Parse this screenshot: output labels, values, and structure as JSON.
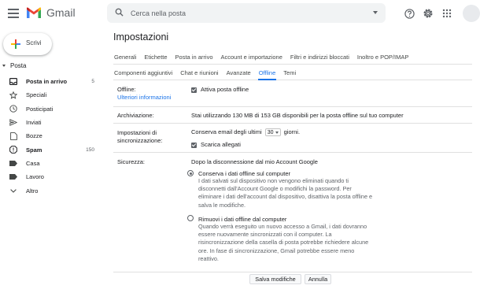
{
  "app": {
    "name": "Gmail"
  },
  "search": {
    "placeholder": "Cerca nella posta"
  },
  "compose": {
    "label": "Scrivi"
  },
  "sidebar": {
    "section": "Posta",
    "items": [
      {
        "label": "Posta in arrivo",
        "count": "5",
        "icon": "inbox-icon",
        "bold": true
      },
      {
        "label": "Speciali",
        "count": "",
        "icon": "star-icon"
      },
      {
        "label": "Posticipati",
        "count": "",
        "icon": "clock-icon"
      },
      {
        "label": "Inviati",
        "count": "",
        "icon": "send-icon"
      },
      {
        "label": "Bozze",
        "count": "",
        "icon": "draft-icon"
      },
      {
        "label": "Spam",
        "count": "150",
        "icon": "spam-icon",
        "bold": true
      },
      {
        "label": "Casa",
        "count": "",
        "icon": "label-icon"
      },
      {
        "label": "Lavoro",
        "count": "",
        "icon": "label-icon"
      },
      {
        "label": "Altro",
        "count": "",
        "icon": "chevron-down-icon"
      }
    ]
  },
  "settings": {
    "title": "Impostazioni",
    "tabs_row1": [
      "Generali",
      "Etichette",
      "Posta in arrivo",
      "Account e importazione",
      "Filtri e indirizzi bloccati",
      "Inoltro e POP/IMAP"
    ],
    "tabs_row2": [
      "Componenti aggiuntivi",
      "Chat e riunioni",
      "Avanzate",
      "Offline",
      "Temi"
    ],
    "active_tab": "Offline",
    "offline": {
      "label": "Offline:",
      "link": "Ulteriori informazioni",
      "checkbox": "Attiva posta offline"
    },
    "storage": {
      "label": "Archiviazione:",
      "text": "Stai utilizzando 130 MB di 153 GB disponibili per la posta offline sul tuo computer"
    },
    "sync": {
      "label_line1": "Impostazioni di",
      "label_line2": "sincronizzazione:",
      "prefix": "Conserva email degli ultimi",
      "days_value": "30",
      "suffix": "giorni.",
      "attachments": "Scarica allegati"
    },
    "security": {
      "label": "Sicurezza:",
      "heading": "Dopo la disconnessione dal mio Account Google",
      "keep_title": "Conserva i dati offline sul computer",
      "keep_desc": "I dati salvati sul dispositivo non vengono eliminati quando ti disconnetti dall'Account Google o modifichi la password. Per eliminare i dati dell'account dal dispositivo, disattiva la posta offline e salva le modifiche.",
      "remove_title": "Rimuovi i dati offline dal computer",
      "remove_desc": "Quando verrà eseguito un nuovo accesso a Gmail, i dati dovranno essere nuovamente sincronizzati con il computer. La risincronizzazione della casella di posta potrebbe richiedere alcune ore. In fase di sincronizzazione, Gmail potrebbe essere meno reattivo."
    },
    "save_label": "Salva modifiche",
    "cancel_label": "Annulla"
  },
  "colors": {
    "accent": "#1a73e8",
    "gmail_red": "#ea4335"
  }
}
